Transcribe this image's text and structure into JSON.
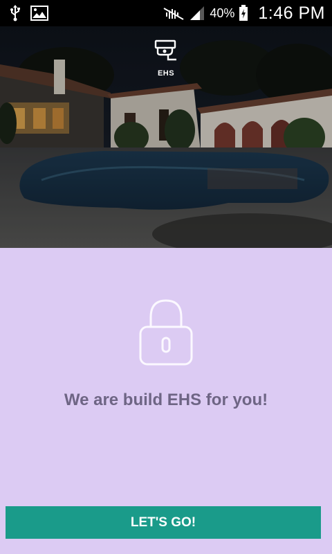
{
  "status_bar": {
    "icons_left": [
      "usb-icon",
      "image-icon"
    ],
    "icons_right": [
      "mute-icon",
      "signal-icon",
      "battery-charging-icon"
    ],
    "battery_percent": "40%",
    "time": "1:46 PM"
  },
  "hero": {
    "logo_icon": "security-camera-icon",
    "logo_text": "EHS"
  },
  "main": {
    "icon": "lock-icon",
    "tagline": "We are build EHS for you!",
    "cta_label": "LET'S GO!"
  },
  "colors": {
    "background": "#dccbf3",
    "button": "#1a9b8a",
    "tagline": "#6e6584",
    "status_bar": "#000000"
  }
}
